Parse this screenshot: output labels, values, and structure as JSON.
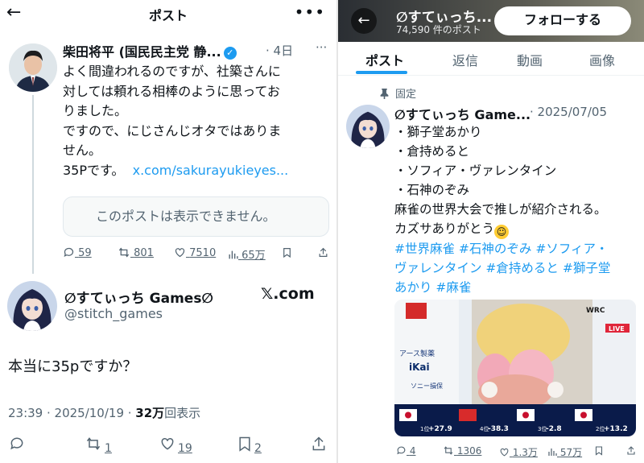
{
  "left": {
    "header": {
      "back_icon": "←",
      "title": "ポスト",
      "more_icon": "•••"
    },
    "quoted": {
      "author": "柴田将平 (国民民主党 静...",
      "verified_icon": "✓",
      "date": "4日",
      "more": "···",
      "lines": [
        "よく間違われるのですが、社築さんに",
        "対しては頼れる相棒のように思ってお",
        "りました。",
        "ですので、にじさんじオタではありま",
        "せん。"
      ],
      "last_line_prefix": "35Pです。",
      "link": "x.com/sakurayukieyes...",
      "unavailable": "このポストは表示できません。",
      "replies": "59",
      "reposts": "801",
      "likes": "7510",
      "views": "65万"
    },
    "post": {
      "name": "∅すてぃっち Games∅",
      "handle": "@stitch_games",
      "brand": "𝕏.com",
      "text": "本当に35pですか？",
      "timestamp": "23:39 · 2025/10/19 · ",
      "views_count": "32万",
      "views_label": "回表示",
      "replies": "",
      "reposts": "1",
      "likes": "19",
      "bookmarks": "2"
    }
  },
  "right": {
    "header": {
      "name": "∅すてぃっち...",
      "count": "74,590 件のポスト",
      "follow": "フォローする"
    },
    "tabs": [
      "ポスト",
      "返信",
      "動画",
      "画像"
    ],
    "pinned_label": "固定",
    "post": {
      "author": "∅すてぃっち Game...",
      "date": "· 2025/07/05",
      "lines": [
        "・獅子堂あかり",
        "・倉持めると",
        "・ソフィア・ヴァレンタイン",
        "・石神のぞみ",
        "麻雀の世界大会で推しが紹介される。"
      ],
      "thanks": "カズサありがとう",
      "tags_line1": "#世界麻雀 #石神のぞみ #ソフィア・",
      "tags_line2": "ヴァレンタイン #倉持めると #獅子堂",
      "tags_line3": "あかり #麻雀",
      "replies": "4",
      "reposts": "1306",
      "likes": "1.3万",
      "views": "57万"
    },
    "media": {
      "live": "LIVE",
      "wrc": "WRC",
      "sponsor1": "アース製薬",
      "sponsor2": "ソニー損保",
      "scores": [
        "+27.9",
        "-38.3",
        "-2.8",
        "+13.2"
      ],
      "ranks": [
        "1位",
        "4位",
        "3位",
        "2位"
      ]
    }
  }
}
